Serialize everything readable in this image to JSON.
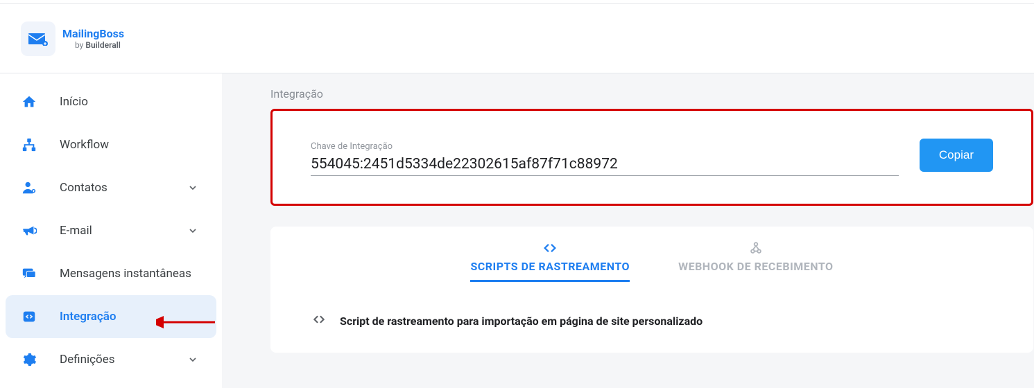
{
  "brand": {
    "name": "MailingBoss",
    "by_prefix": "by ",
    "by_brand": "Builderall"
  },
  "sidebar": {
    "items": [
      {
        "label": "Início",
        "expandable": false,
        "active": false
      },
      {
        "label": "Workflow",
        "expandable": false,
        "active": false
      },
      {
        "label": "Contatos",
        "expandable": true,
        "active": false
      },
      {
        "label": "E-mail",
        "expandable": true,
        "active": false
      },
      {
        "label": "Mensagens instantâneas",
        "expandable": false,
        "active": false
      },
      {
        "label": "Integração",
        "expandable": false,
        "active": true
      },
      {
        "label": "Definições",
        "expandable": true,
        "active": false
      }
    ]
  },
  "main": {
    "section_title": "Integração",
    "key_label": "Chave de Integração",
    "key_value": "554045:2451d5334de22302615af87f71c88972",
    "copy_button": "Copiar",
    "tabs": [
      {
        "label": "SCRIPTS DE RASTREAMENTO",
        "active": true
      },
      {
        "label": "WEBHOOK DE RECEBIMENTO",
        "active": false
      }
    ],
    "script_row_title": "Script de rastreamento para importação em página de site personalizado"
  }
}
